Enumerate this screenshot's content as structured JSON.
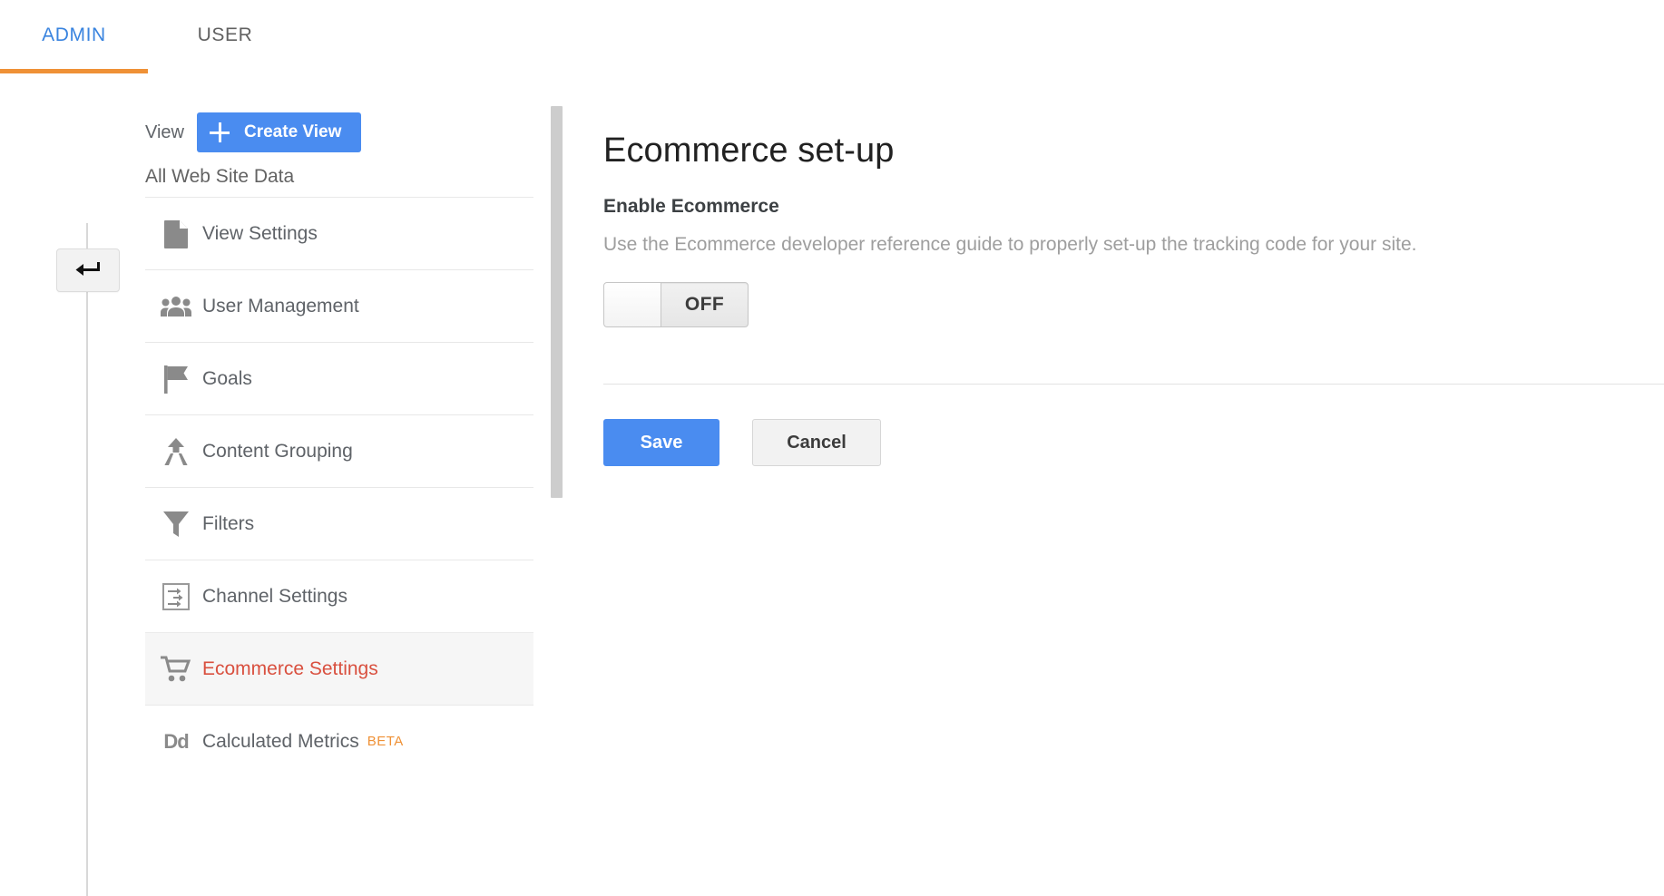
{
  "tabs": {
    "admin": "ADMIN",
    "user": "USER",
    "active": "ADMIN",
    "accent_color": "#ef9136",
    "active_color": "#3a84df"
  },
  "collapse": {
    "icon": "back-arrow-icon",
    "tooltip": "Collapse"
  },
  "sidebar": {
    "column_label": "View",
    "create_button": "Create View",
    "view_name": "All Web Site Data",
    "active_item": "Ecommerce Settings",
    "active_color": "#d9503f",
    "items": [
      {
        "label": "View Settings",
        "icon": "document-icon"
      },
      {
        "label": "User Management",
        "icon": "people-icon"
      },
      {
        "label": "Goals",
        "icon": "flag-icon"
      },
      {
        "label": "Content Grouping",
        "icon": "content-grouping-icon"
      },
      {
        "label": "Filters",
        "icon": "funnel-icon"
      },
      {
        "label": "Channel Settings",
        "icon": "channel-settings-icon"
      },
      {
        "label": "Ecommerce Settings",
        "icon": "shopping-cart-icon"
      },
      {
        "label": "Calculated Metrics",
        "icon": "dd-icon",
        "badge": "BETA",
        "badge_color": "#ef9136"
      }
    ]
  },
  "main": {
    "title": "Ecommerce set-up",
    "section_title": "Enable Ecommerce",
    "description": "Use the Ecommerce developer reference guide to properly set-up the tracking code for your site.",
    "toggle": {
      "state_label": "OFF",
      "value": "off"
    },
    "save_label": "Save",
    "cancel_label": "Cancel",
    "save_color": "#4a8cf0"
  }
}
